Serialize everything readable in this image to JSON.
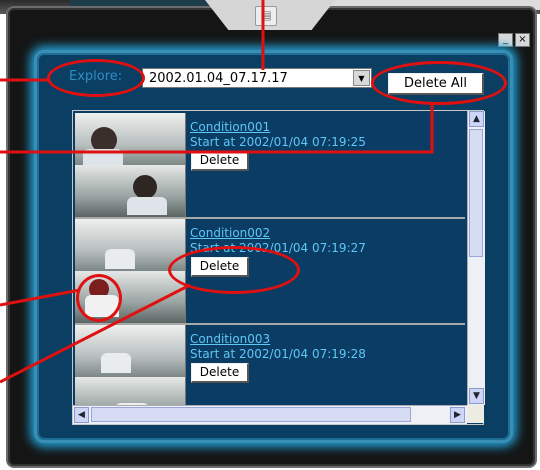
{
  "window": {
    "minimize_label": "_",
    "close_label": "×",
    "notch_icon": "document-icon"
  },
  "toolbar": {
    "explore_label": "Explore:",
    "explore_value": "2002.01.04_07.17.17",
    "delete_all_label": "Delete All"
  },
  "items": [
    {
      "name": "Condition001",
      "start": "Start at 2002/01/04 07:19:25",
      "delete_label": "Delete"
    },
    {
      "name": "Condition002",
      "start": "Start at 2002/01/04 07:19:27",
      "delete_label": "Delete"
    },
    {
      "name": "Condition003",
      "start": "Start at 2002/01/04 07:19:28",
      "delete_label": "Delete"
    }
  ],
  "scrollbar": {
    "up": "▲",
    "down": "▼",
    "left": "◀",
    "right": "▶"
  },
  "colors": {
    "panel": "#0a3f63",
    "glow": "#21a0d6",
    "link": "#5ec7f6",
    "annotation": "#e01010"
  }
}
